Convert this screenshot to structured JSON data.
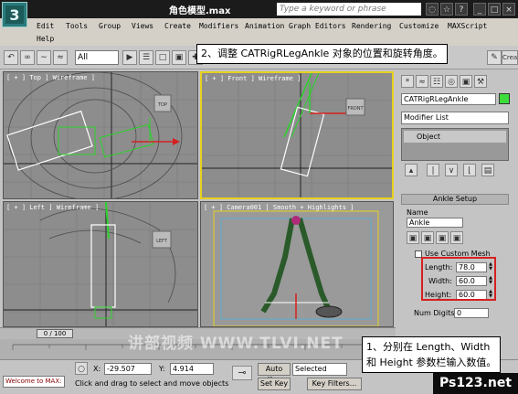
{
  "window": {
    "title": "角色模型.max",
    "search_placeholder": "Type a keyword or phrase"
  },
  "menu": [
    "Edit",
    "Tools",
    "Group",
    "Views",
    "Create",
    "Modifiers",
    "Animation",
    "Graph Editors",
    "Rendering",
    "Customize",
    "MAXScript",
    "Help"
  ],
  "toolbar": {
    "selection_filter": "All"
  },
  "viewports": {
    "top": "[ + ] Top ] Wireframe ]",
    "front": "[ + ] Front ] Wireframe ]",
    "left": "[ + ] Left ] Wireframe ]",
    "camera": "[ + ] Camera001 ] Smooth + Highlights ]"
  },
  "gizmo_labels": {
    "top": "TOP",
    "front": "FRONT",
    "left": "LEFT"
  },
  "command_panel": {
    "object_name": "CATRigRLegAnkle",
    "object_color": "#3ddc3d",
    "modifier_list": "Modifier List",
    "stack_item": "Object",
    "rollout_title": "Ankle Setup",
    "name_label": "Name",
    "name_value": "Ankle",
    "use_custom_mesh": "Use Custom Mesh",
    "length_label": "Length:",
    "length_value": "78.0",
    "width_label": "Width:",
    "width_value": "60.0",
    "height_label": "Height:",
    "height_value": "60.0",
    "num_digits_label": "Num Digits:",
    "num_digits_value": "0"
  },
  "timeline": {
    "frame": "0 / 100"
  },
  "status": {
    "maxscript": "Welcome to MAX:",
    "message": "Click and drag to select and move objects",
    "x_label": "X:",
    "x_value": "-29.507",
    "y_label": "Y:",
    "y_value": "4.914",
    "auto_key": "Auto Key",
    "set_key": "Set Key",
    "selected": "Selected",
    "key_filters": "Key Filters..."
  },
  "callouts": {
    "step2": "2、调整 CATRigRLegAnkle 对象的位置和旋转角度。",
    "step1_line1": "1、分别在 Length、Width",
    "step1_line2": "和 Height 参数栏输入数值。"
  },
  "watermark": "讲部视频 WWW.TLVI.NET",
  "site_logo": "Ps123.net"
}
